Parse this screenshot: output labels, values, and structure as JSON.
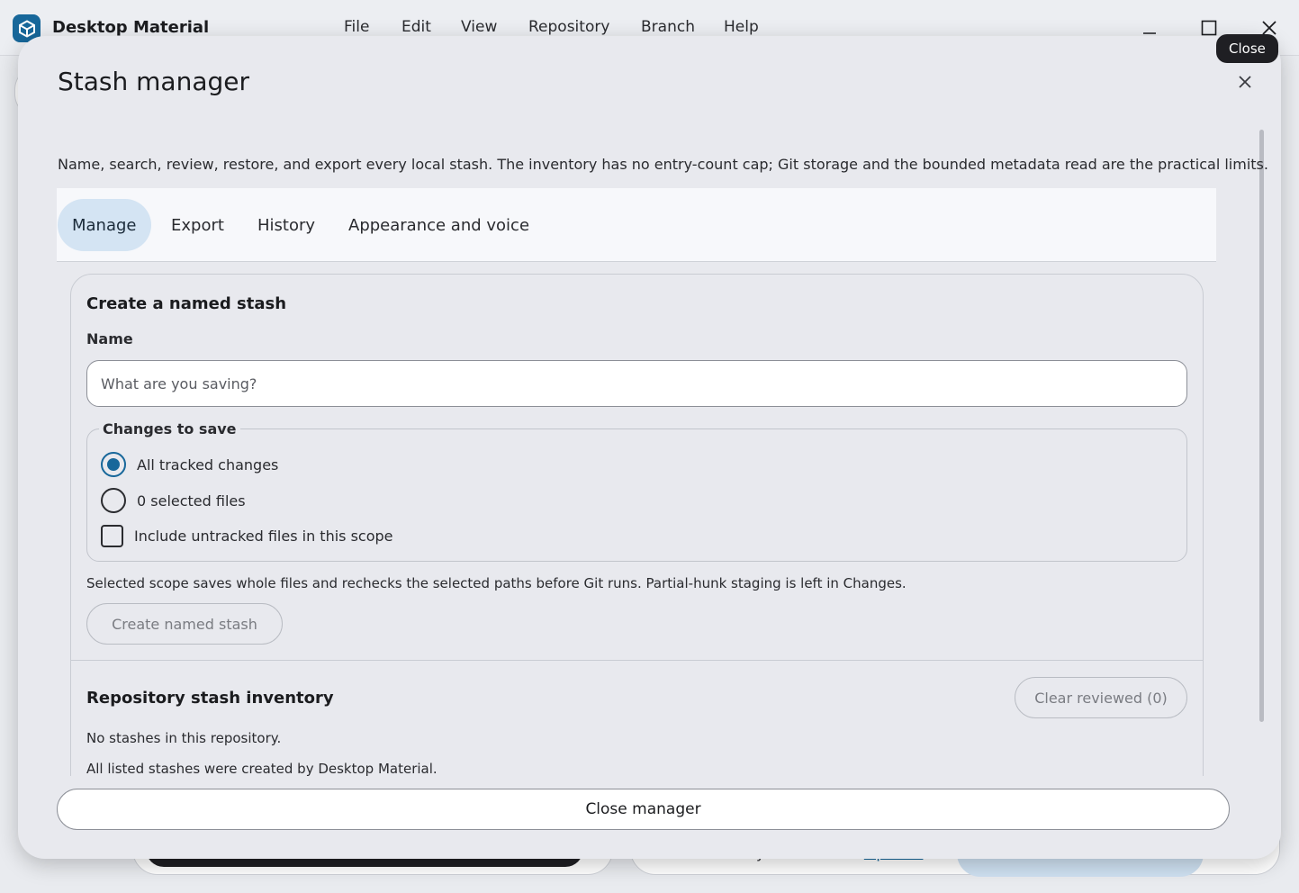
{
  "app": {
    "name": "Desktop Material",
    "menu": [
      "File",
      "Edit",
      "View",
      "Repository",
      "Branch",
      "Help"
    ]
  },
  "tooltip": {
    "text": "Close"
  },
  "background": {
    "editor_text": "Select your editor in",
    "editor_link": "Options"
  },
  "dialog": {
    "title": "Stash manager",
    "description": "Name, search, review, restore, and export every local stash. The inventory has no entry-count cap; Git storage and the bounded metadata read are the practical limits.",
    "tabs": [
      {
        "label": "Manage",
        "active": true
      },
      {
        "label": "Export",
        "active": false
      },
      {
        "label": "History",
        "active": false
      },
      {
        "label": "Appearance and voice",
        "active": false
      }
    ],
    "create": {
      "title": "Create a named stash",
      "name_label": "Name",
      "name_value": "",
      "name_placeholder": "What are you saving?",
      "changes_legend": "Changes to save",
      "options": {
        "all_tracked": {
          "label": "All tracked changes",
          "checked": true
        },
        "selected_files": {
          "label": "0 selected files",
          "checked": false
        },
        "include_untracked": {
          "label": "Include untracked files in this scope",
          "checked": false
        }
      },
      "hint": "Selected scope saves whole files and rechecks the selected paths before Git runs. Partial-hunk staging is left in Changes.",
      "create_button": "Create named stash"
    },
    "inventory": {
      "title": "Repository stash inventory",
      "clear_button": "Clear reviewed (0)",
      "empty_text": "No stashes in this repository.",
      "note": "All listed stashes were created by Desktop Material."
    },
    "close_button": "Close manager"
  },
  "colors": {
    "accent": "#17679a",
    "active_tab": "#d4e4f3",
    "dialog_bg": "#e8e9ee"
  }
}
